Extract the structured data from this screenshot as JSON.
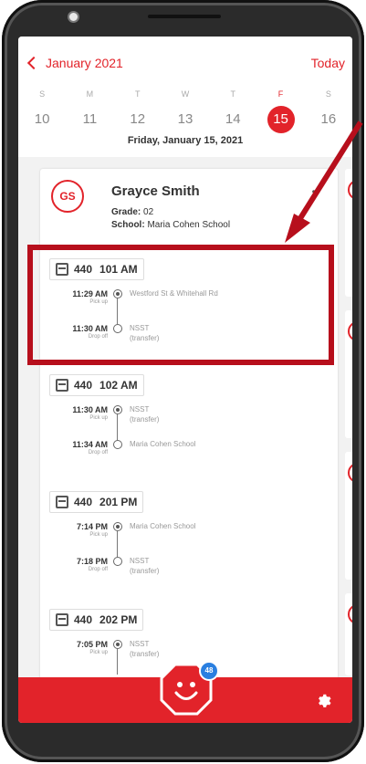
{
  "header": {
    "month_label": "January 2021",
    "today_label": "Today",
    "days": [
      {
        "dow": "S",
        "num": "10"
      },
      {
        "dow": "M",
        "num": "11"
      },
      {
        "dow": "T",
        "num": "12"
      },
      {
        "dow": "W",
        "num": "13"
      },
      {
        "dow": "T",
        "num": "14"
      },
      {
        "dow": "F",
        "num": "15"
      },
      {
        "dow": "S",
        "num": "16"
      }
    ],
    "selected_date": "Friday, January 15, 2021"
  },
  "student": {
    "initials": "GS",
    "name": "Grayce Smith",
    "grade_label": "Grade:",
    "grade": "02",
    "school_label": "School:",
    "school": "Maria Cohen School",
    "more_icon": "more-dots-icon"
  },
  "trips": [
    {
      "route": "440",
      "name": "101 AM",
      "stops": [
        {
          "time": "11:29 AM",
          "type": "Pick up",
          "place": "Westford St & Whitehall Rd",
          "sub": ""
        },
        {
          "time": "11:30 AM",
          "type": "Drop off",
          "place": "NSST",
          "sub": "(transfer)"
        }
      ]
    },
    {
      "route": "440",
      "name": "102 AM",
      "stops": [
        {
          "time": "11:30 AM",
          "type": "Pick up",
          "place": "NSST",
          "sub": "(transfer)"
        },
        {
          "time": "11:34 AM",
          "type": "Drop off",
          "place": "Maria Cohen School",
          "sub": ""
        }
      ]
    },
    {
      "route": "440",
      "name": "201 PM",
      "stops": [
        {
          "time": "7:14 PM",
          "type": "Pick up",
          "place": "Maria Cohen School",
          "sub": ""
        },
        {
          "time": "7:18 PM",
          "type": "Drop off",
          "place": "NSST",
          "sub": "(transfer)"
        }
      ]
    },
    {
      "route": "440",
      "name": "202 PM",
      "stops": [
        {
          "time": "7:05 PM",
          "type": "Pick up",
          "place": "NSST",
          "sub": "(transfer)"
        }
      ]
    }
  ],
  "bottom": {
    "badge_count": "48",
    "logo_icon": "smiley-stop-sign-icon",
    "settings_icon": "gear-icon"
  },
  "colors": {
    "accent": "#e2232a",
    "highlight": "#b70f1c",
    "badge": "#2a7fe0"
  }
}
